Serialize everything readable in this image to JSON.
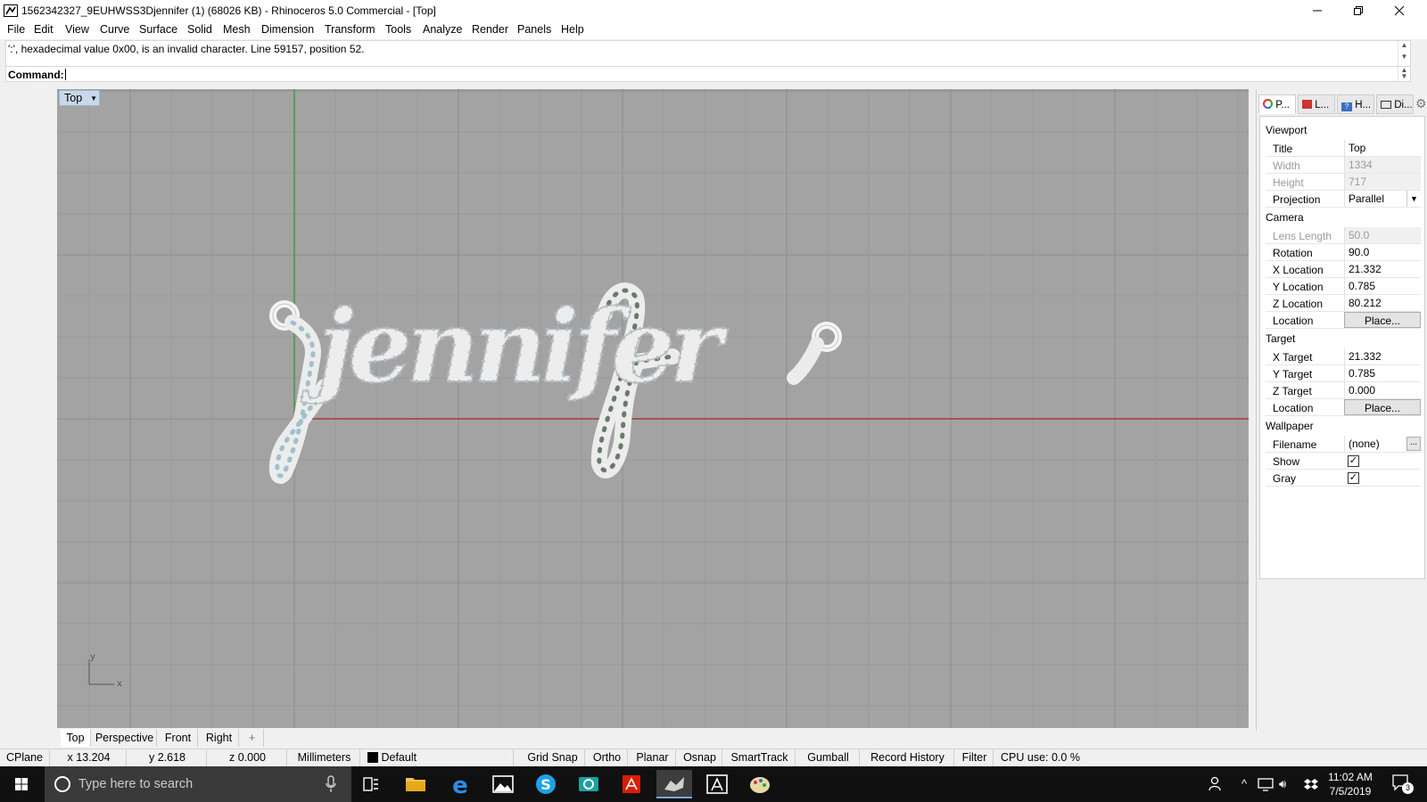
{
  "window": {
    "title": "1562342327_9EUHWSS3Djennifer (1) (68026 KB) - Rhinoceros 5.0 Commercial - [Top]"
  },
  "menu": [
    "File",
    "Edit",
    "View",
    "Curve",
    "Surface",
    "Solid",
    "Mesh",
    "Dimension",
    "Transform",
    "Tools",
    "Analyze",
    "Render",
    "Panels",
    "Help"
  ],
  "command": {
    "history": "':', hexadecimal value 0x00, is an invalid character. Line 59157, position 52.",
    "prompt_label": "Command:",
    "value": ""
  },
  "viewport": {
    "title": "Top",
    "model_text": "jennifer",
    "axis_y": "y",
    "axis_x": "x",
    "tabs": [
      "Top",
      "Perspective",
      "Front",
      "Right"
    ],
    "active_tab": "Top"
  },
  "panel": {
    "tabs": [
      "P...",
      "L...",
      "H...",
      "Di..."
    ],
    "sections": {
      "viewport": "Viewport",
      "camera": "Camera",
      "target": "Target",
      "wallpaper": "Wallpaper"
    },
    "viewport_props": {
      "title_label": "Title",
      "title_value": "Top",
      "width_label": "Width",
      "width_value": "1334",
      "height_label": "Height",
      "height_value": "717",
      "projection_label": "Projection",
      "projection_value": "Parallel"
    },
    "camera_props": {
      "lens_label": "Lens Length",
      "lens_value": "50.0",
      "rotation_label": "Rotation",
      "rotation_value": "90.0",
      "xloc_label": "X Location",
      "xloc_value": "21.332",
      "yloc_label": "Y Location",
      "yloc_value": "0.785",
      "zloc_label": "Z Location",
      "zloc_value": "80.212",
      "location_label": "Location",
      "place_label": "Place..."
    },
    "target_props": {
      "xt_label": "X Target",
      "xt_value": "21.332",
      "yt_label": "Y Target",
      "yt_value": "0.785",
      "zt_label": "Z Target",
      "zt_value": "0.000",
      "location_label": "Location",
      "place_label": "Place..."
    },
    "wallpaper_props": {
      "filename_label": "Filename",
      "filename_value": "(none)",
      "show_label": "Show",
      "show_checked": true,
      "gray_label": "Gray",
      "gray_checked": true
    }
  },
  "status": {
    "cplane": "CPlane",
    "x": "x 13.204",
    "y": "y 2.618",
    "z": "z 0.000",
    "units": "Millimeters",
    "layer": "Default",
    "grid_snap": "Grid Snap",
    "ortho": "Ortho",
    "planar": "Planar",
    "osnap": "Osnap",
    "smarttrack": "SmartTrack",
    "gumball": "Gumball",
    "record_history": "Record History",
    "filter": "Filter",
    "cpu": "CPU use: 0.0 %"
  },
  "taskbar": {
    "search_placeholder": "Type here to search",
    "time": "11:02 AM",
    "date": "7/5/2019",
    "notification_count": "3"
  }
}
